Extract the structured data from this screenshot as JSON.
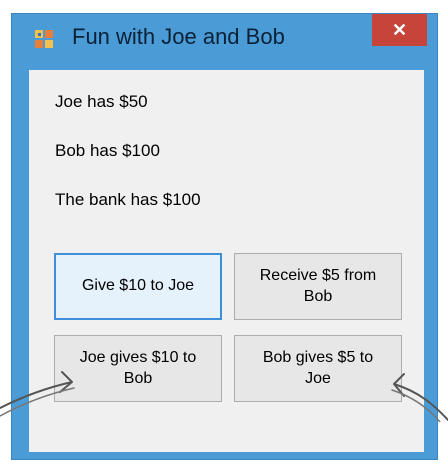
{
  "window": {
    "title": "Fun with Joe and Bob",
    "close_glyph": "✕"
  },
  "labels": {
    "joe": "Joe has $50",
    "bob": "Bob has $100",
    "bank": "The bank has $100"
  },
  "buttons": {
    "give_joe": "Give $10 to Joe",
    "receive_bob": "Receive $5 from Bob",
    "joe_gives": "Joe gives $10 to Bob",
    "bob_gives": "Bob gives $5 to Joe"
  },
  "colors": {
    "titlebar": "#4a9bd6",
    "close": "#c7443a",
    "client": "#f0f0f0"
  },
  "icons": {
    "app": "app-icon",
    "close": "close-icon",
    "annotation_left": "hand-drawn-arrow-icon",
    "annotation_right": "hand-drawn-arrow-icon"
  }
}
